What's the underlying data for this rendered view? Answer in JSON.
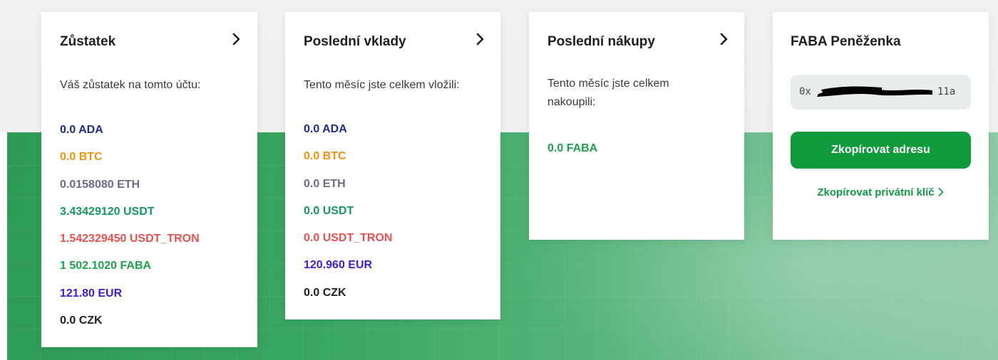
{
  "colors": {
    "ADA": "#1f2d8a",
    "BTC": "#f2920c",
    "ETH": "#6a6a8f",
    "USDT": "#139a5c",
    "USDT_TRON": "#e9514f",
    "FABA": "#1ea34a",
    "EUR": "#3b1fd9",
    "CZK": "#222222",
    "button_green": "#0f9a3c",
    "link_green": "#139a45"
  },
  "balance": {
    "title": "Zůstatek",
    "description": "Váš zůstatek na tomto účtu:",
    "items": [
      {
        "text": "0.0 ADA",
        "currency": "ADA"
      },
      {
        "text": "0.0 BTC",
        "currency": "BTC"
      },
      {
        "text": "0.0158080 ETH",
        "currency": "ETH"
      },
      {
        "text": "3.43429120 USDT",
        "currency": "USDT"
      },
      {
        "text": "1.542329450 USDT_TRON",
        "currency": "USDT_TRON"
      },
      {
        "text": "1 502.1020 FABA",
        "currency": "FABA"
      },
      {
        "text": "121.80 EUR",
        "currency": "EUR"
      },
      {
        "text": "0.0 CZK",
        "currency": "CZK"
      }
    ]
  },
  "deposits": {
    "title": "Poslední vklady",
    "description": "Tento měsíc jste celkem vložili:",
    "items": [
      {
        "text": "0.0 ADA",
        "currency": "ADA"
      },
      {
        "text": "0.0 BTC",
        "currency": "BTC"
      },
      {
        "text": "0.0 ETH",
        "currency": "ETH"
      },
      {
        "text": "0.0 USDT",
        "currency": "USDT"
      },
      {
        "text": "0.0 USDT_TRON",
        "currency": "USDT_TRON"
      },
      {
        "text": "120.960 EUR",
        "currency": "EUR"
      },
      {
        "text": "0.0 CZK",
        "currency": "CZK"
      }
    ]
  },
  "purchases": {
    "title": "Poslední nákupy",
    "description_line1": "Tento měsíc jste celkem",
    "description_line2": "nakoupili:",
    "items": [
      {
        "text": "0.0 FABA",
        "currency": "FABA"
      }
    ]
  },
  "wallet": {
    "title": "FABA Peněženka",
    "address_prefix": "0x",
    "address_suffix": "11a",
    "copy_button": "Zkopírovat adresu",
    "private_key_link": "Zkopírovat privátní klíč"
  },
  "icons": {
    "card_arrow": "chevron-right-icon",
    "link_arrow": "chevron-right-icon"
  }
}
